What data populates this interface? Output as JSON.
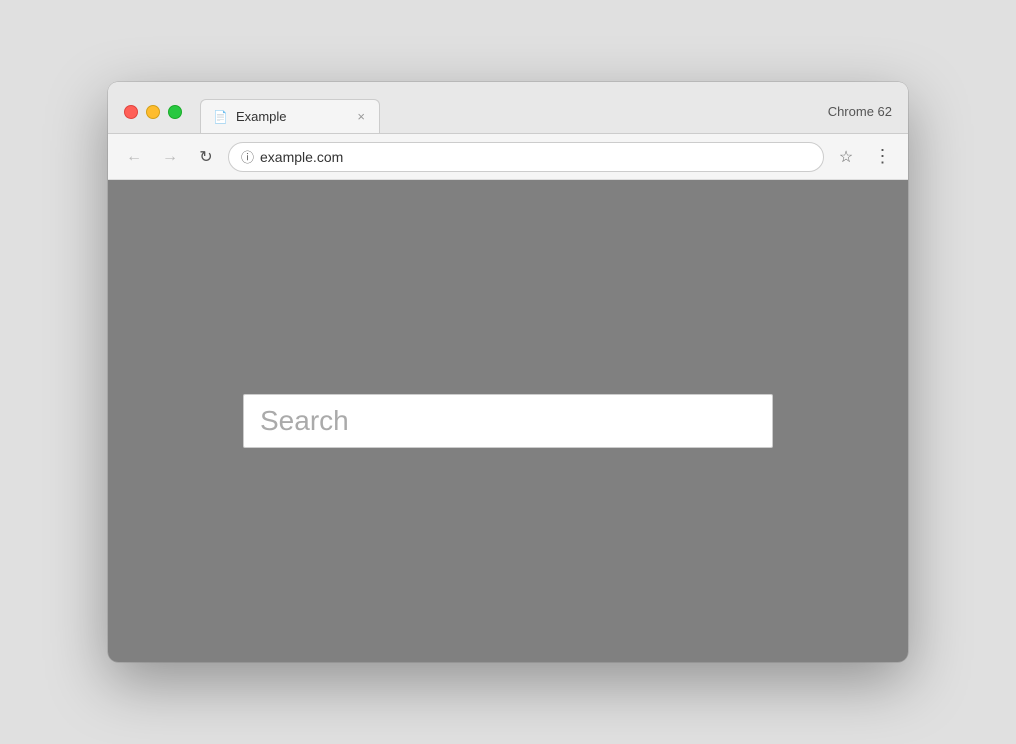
{
  "browser": {
    "chrome_version": "Chrome 62",
    "tab": {
      "icon": "📄",
      "title": "Example",
      "close": "×"
    },
    "toolbar": {
      "back_label": "←",
      "forward_label": "→",
      "reload_label": "↻",
      "address": "example.com",
      "star_label": "☆",
      "menu_label": "⋮"
    }
  },
  "page": {
    "search_placeholder": "Search"
  }
}
